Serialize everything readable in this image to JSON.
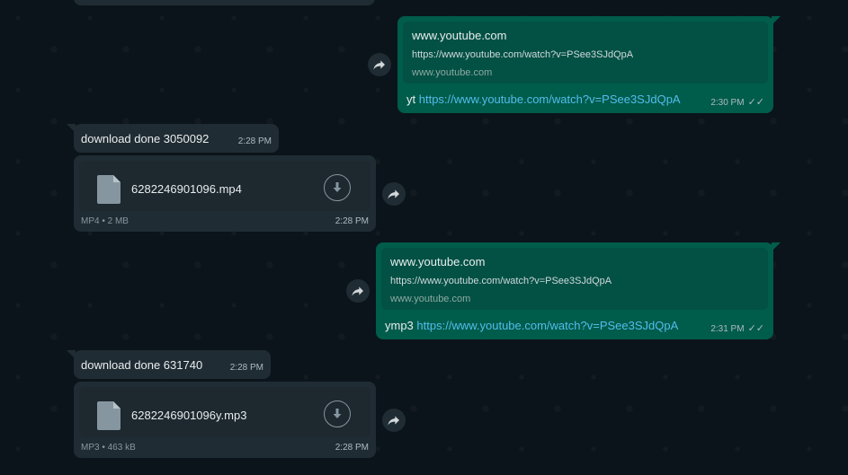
{
  "messages": {
    "out1": {
      "preview_domain": "www.youtube.com",
      "preview_url": "https://www.youtube.com/watch?v=PSee3SJdQpA",
      "preview_site": "www.youtube.com",
      "prefix": "yt",
      "link": "https://www.youtube.com/watch?v=PSee3SJdQpA",
      "time": "2:30 PM",
      "ticks": "✓✓"
    },
    "in1": {
      "text": "download done 3050092",
      "time": "2:28 PM"
    },
    "file1": {
      "name": "6282246901096.mp4",
      "meta": "MP4 • 2 MB",
      "time": "2:28 PM"
    },
    "out2": {
      "preview_domain": "www.youtube.com",
      "preview_url": "https://www.youtube.com/watch?v=PSee3SJdQpA",
      "preview_site": "www.youtube.com",
      "prefix": "ymp3",
      "link": "https://www.youtube.com/watch?v=PSee3SJdQpA",
      "time": "2:31 PM",
      "ticks": "✓✓"
    },
    "in2": {
      "text": "download done 631740",
      "time": "2:28 PM"
    },
    "file2": {
      "name": "6282246901096y.mp3",
      "meta": "MP3 • 463 kB",
      "time": "2:28 PM"
    }
  },
  "colors": {
    "chat_bg": "#0b141a",
    "outgoing_bubble": "#005c4b",
    "incoming_bubble": "#202c33",
    "link": "#53bdeb"
  },
  "icons": {
    "forward": "forward-icon",
    "file": "file-icon",
    "download": "download-icon",
    "read_receipt": "double-check-icon"
  }
}
